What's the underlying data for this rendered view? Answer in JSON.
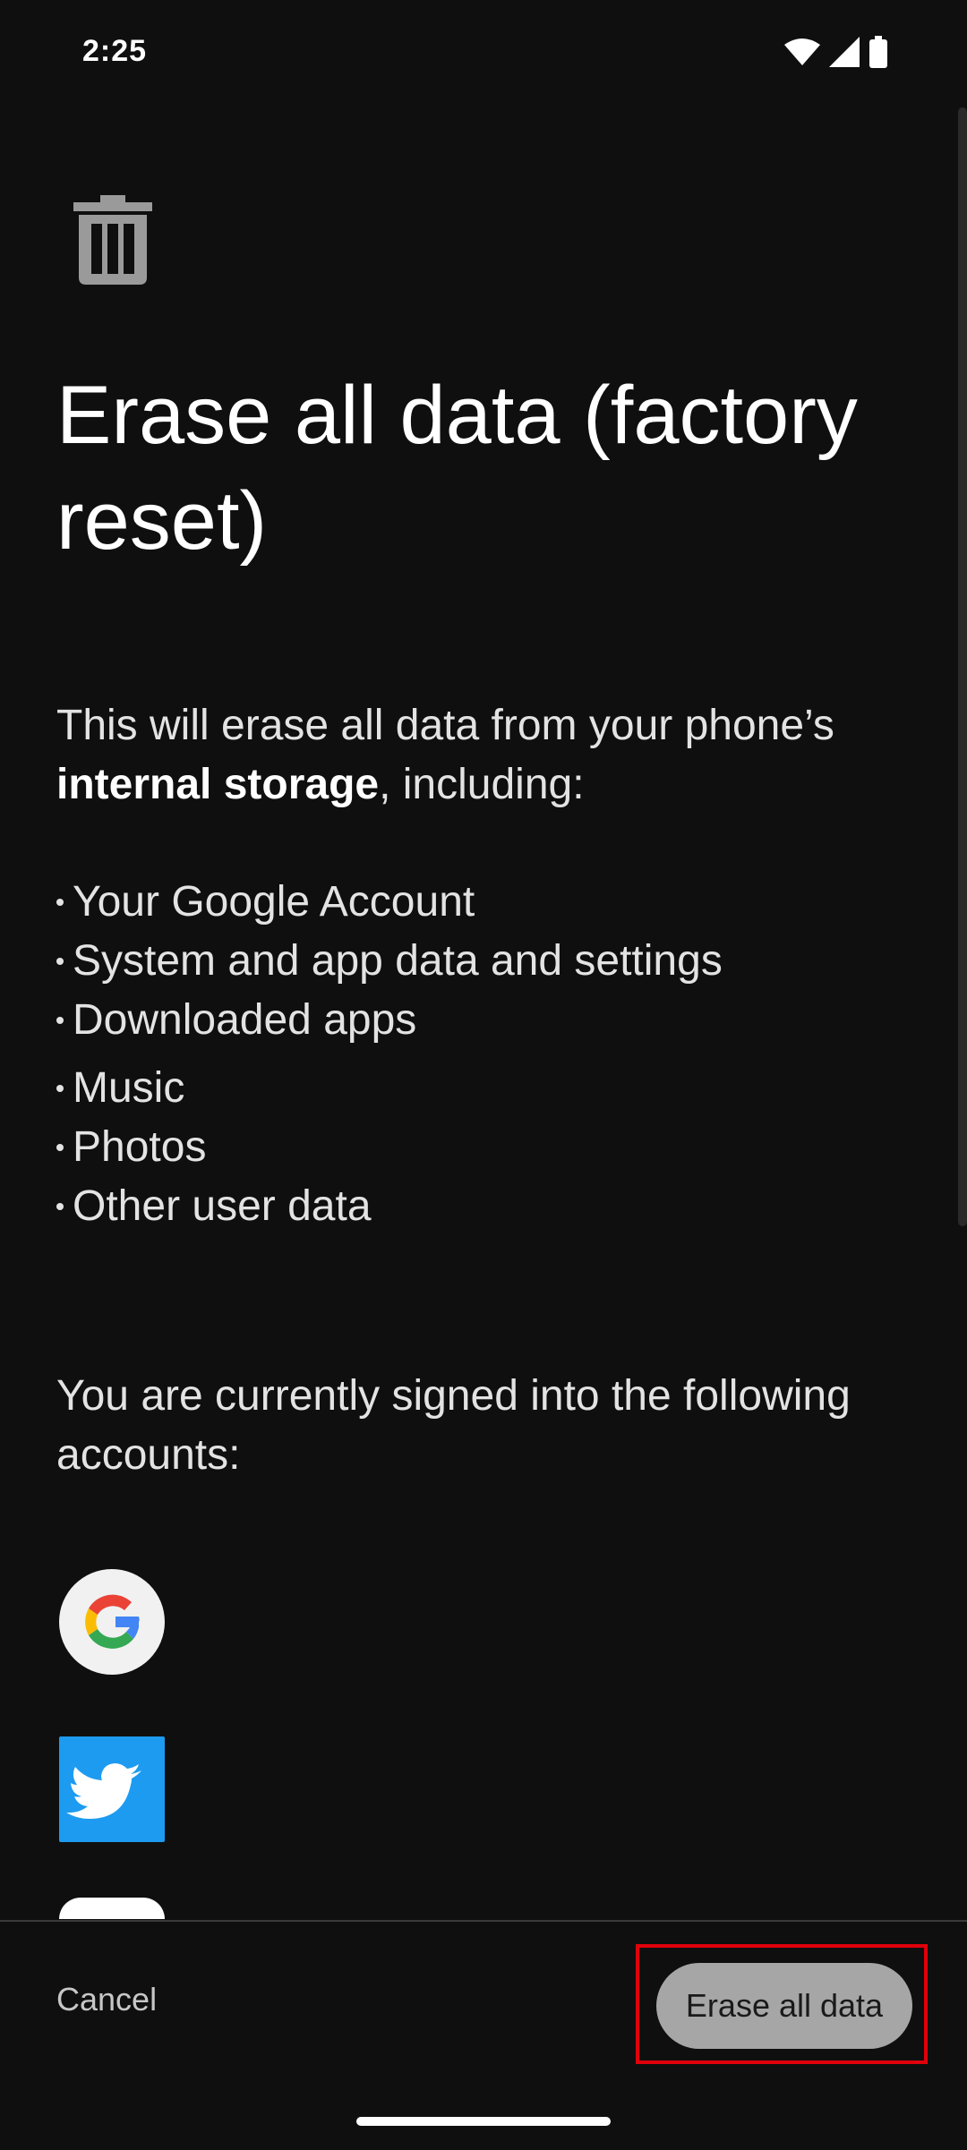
{
  "status_bar": {
    "time": "2:25",
    "icons": [
      "wifi-icon",
      "cellular-signal-icon",
      "battery-icon"
    ]
  },
  "header": {
    "icon": "trash-icon",
    "title": "Erase all data (factory reset)"
  },
  "description": {
    "intro_prefix": "This will erase all data from your phone’s ",
    "intro_bold": "internal storage",
    "intro_suffix": ", including:"
  },
  "erase_items": [
    "Your Google Account",
    "System and app data and settings",
    "Downloaded apps",
    "Music",
    "Photos",
    "Other user data"
  ],
  "accounts": {
    "text": "You are currently signed into the following accounts:",
    "icons": [
      "google-account-icon",
      "twitter-account-icon",
      "account-icon"
    ]
  },
  "actions": {
    "cancel_label": "Cancel",
    "erase_label": "Erase all data"
  },
  "colors": {
    "background": "#0f0f0f",
    "erase_button": "#a6a6a6",
    "highlight_outline": "#e0000b",
    "twitter_blue": "#1d9bf0"
  }
}
